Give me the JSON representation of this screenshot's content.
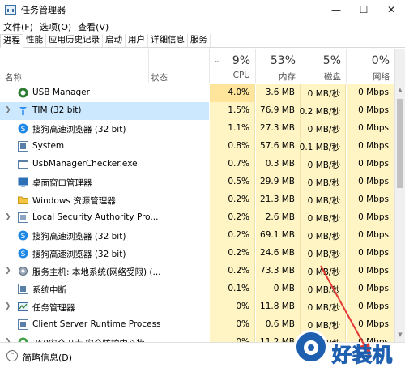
{
  "window": {
    "title": "任务管理器",
    "icon": "task-manager-icon",
    "controls": [
      "minimize-icon",
      "maximize-icon",
      "close-icon"
    ]
  },
  "menu": [
    "文件(F)",
    "选项(O)",
    "查看(V)"
  ],
  "tabs": [
    "进程",
    "性能",
    "应用历史记录",
    "启动",
    "用户",
    "详细信息",
    "服务"
  ],
  "active_tab": "进程",
  "columns": {
    "name": "名称",
    "status": "状态",
    "cpu": {
      "pct": "9%",
      "label": "CPU"
    },
    "mem": {
      "pct": "53%",
      "label": "内存"
    },
    "disk": {
      "pct": "5%",
      "label": "磁盘"
    },
    "net": {
      "pct": "0%",
      "label": "网络"
    }
  },
  "processes": [
    {
      "name": "USB Manager",
      "expandable": false,
      "icon": "usb-manager-icon",
      "cpu": "4.0%",
      "mem": "3.6 MB",
      "disk": "0 MB/秒",
      "net": "0 Mbps",
      "selected": false
    },
    {
      "name": "TIM (32 bit)",
      "expandable": true,
      "icon": "tim-icon",
      "cpu": "1.5%",
      "mem": "76.9 MB",
      "disk": "0.2 MB/秒",
      "net": "0 Mbps",
      "selected": true
    },
    {
      "name": "搜狗高速浏览器 (32 bit)",
      "expandable": false,
      "icon": "sogou-browser-icon",
      "cpu": "1.1%",
      "mem": "27.3 MB",
      "disk": "0 MB/秒",
      "net": "0 Mbps",
      "selected": false
    },
    {
      "name": "System",
      "expandable": false,
      "icon": "system-icon",
      "cpu": "0.8%",
      "mem": "57.6 MB",
      "disk": "0.1 MB/秒",
      "net": "0 Mbps",
      "selected": false
    },
    {
      "name": "UsbManagerChecker.exe",
      "expandable": false,
      "icon": "exe-icon",
      "cpu": "0.7%",
      "mem": "0.3 MB",
      "disk": "0 MB/秒",
      "net": "0 Mbps",
      "selected": false
    },
    {
      "name": "桌面窗口管理器",
      "expandable": false,
      "icon": "dwm-icon",
      "cpu": "0.5%",
      "mem": "29.9 MB",
      "disk": "0 MB/秒",
      "net": "0 Mbps",
      "selected": false
    },
    {
      "name": "Windows 资源管理器",
      "expandable": false,
      "icon": "explorer-folder-icon",
      "cpu": "0.2%",
      "mem": "21.3 MB",
      "disk": "0 MB/秒",
      "net": "0 Mbps",
      "selected": false
    },
    {
      "name": "Local Security Authority Pro...",
      "expandable": true,
      "icon": "lsa-icon",
      "cpu": "0.2%",
      "mem": "2.6 MB",
      "disk": "0 MB/秒",
      "net": "0 Mbps",
      "selected": false
    },
    {
      "name": "搜狗高速浏览器 (32 bit)",
      "expandable": false,
      "icon": "sogou-browser-icon",
      "cpu": "0.2%",
      "mem": "69.1 MB",
      "disk": "0 MB/秒",
      "net": "0 Mbps",
      "selected": false
    },
    {
      "name": "搜狗高速浏览器 (32 bit)",
      "expandable": false,
      "icon": "sogou-browser-icon",
      "cpu": "0.2%",
      "mem": "24.6 MB",
      "disk": "0 MB/秒",
      "net": "0 Mbps",
      "selected": false
    },
    {
      "name": "服务主机: 本地系统(网络受限) (...",
      "expandable": true,
      "icon": "gear-icon",
      "cpu": "0.2%",
      "mem": "73.3 MB",
      "disk": "0 MB/秒",
      "net": "0 Mbps",
      "selected": false
    },
    {
      "name": "系统中断",
      "expandable": false,
      "icon": "system-icon",
      "cpu": "0.1%",
      "mem": "0 MB",
      "disk": "0 MB/秒",
      "net": "0 Mbps",
      "selected": false
    },
    {
      "name": "任务管理器",
      "expandable": true,
      "icon": "task-manager-icon",
      "cpu": "0%",
      "mem": "11.8 MB",
      "disk": "0 MB/秒",
      "net": "0 Mbps",
      "selected": false
    },
    {
      "name": "Client Server Runtime Process",
      "expandable": false,
      "icon": "system-icon",
      "cpu": "0%",
      "mem": "0.6 MB",
      "disk": "0 MB/秒",
      "net": "0 Mbps",
      "selected": false
    },
    {
      "name": "360安全卫士 安全防护中心模...",
      "expandable": true,
      "icon": "360-icon",
      "cpu": "0%",
      "mem": "11.2 MB",
      "disk": "0 MB/秒",
      "net": "0 Mbps",
      "selected": false
    }
  ],
  "footer": {
    "label": "简略信息(D)",
    "icon": "collapse-up-icon"
  },
  "watermark": {
    "text": "好装机",
    "icon": "watermark-eye-icon"
  },
  "colors": {
    "cpu_cell": "#fff4c4",
    "cpu_cell_hot": "#ffe59c",
    "mem_cell": "#fff4c4",
    "disk_cell": "#fff4c4",
    "net_cell": "#fff4c4",
    "selected_row": "#cce8ff",
    "annotation_arrow": "#e53935"
  }
}
